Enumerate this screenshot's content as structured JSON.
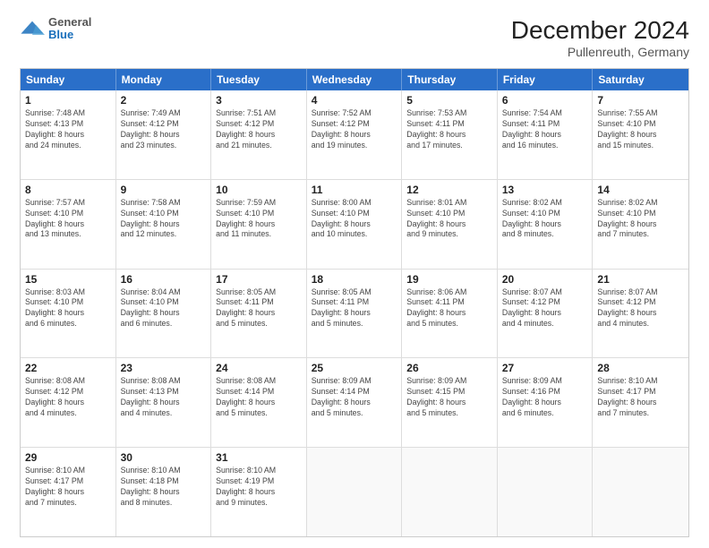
{
  "header": {
    "logo": {
      "general": "General",
      "blue": "Blue"
    },
    "title": "December 2024",
    "subtitle": "Pullenreuth, Germany"
  },
  "calendar": {
    "days_of_week": [
      "Sunday",
      "Monday",
      "Tuesday",
      "Wednesday",
      "Thursday",
      "Friday",
      "Saturday"
    ],
    "weeks": [
      [
        {
          "day": "",
          "info": ""
        },
        {
          "day": "2",
          "info": "Sunrise: 7:49 AM\nSunset: 4:12 PM\nDaylight: 8 hours\nand 23 minutes."
        },
        {
          "day": "3",
          "info": "Sunrise: 7:51 AM\nSunset: 4:12 PM\nDaylight: 8 hours\nand 21 minutes."
        },
        {
          "day": "4",
          "info": "Sunrise: 7:52 AM\nSunset: 4:12 PM\nDaylight: 8 hours\nand 19 minutes."
        },
        {
          "day": "5",
          "info": "Sunrise: 7:53 AM\nSunset: 4:11 PM\nDaylight: 8 hours\nand 17 minutes."
        },
        {
          "day": "6",
          "info": "Sunrise: 7:54 AM\nSunset: 4:11 PM\nDaylight: 8 hours\nand 16 minutes."
        },
        {
          "day": "7",
          "info": "Sunrise: 7:55 AM\nSunset: 4:10 PM\nDaylight: 8 hours\nand 15 minutes."
        }
      ],
      [
        {
          "day": "8",
          "info": "Sunrise: 7:57 AM\nSunset: 4:10 PM\nDaylight: 8 hours\nand 13 minutes."
        },
        {
          "day": "9",
          "info": "Sunrise: 7:58 AM\nSunset: 4:10 PM\nDaylight: 8 hours\nand 12 minutes."
        },
        {
          "day": "10",
          "info": "Sunrise: 7:59 AM\nSunset: 4:10 PM\nDaylight: 8 hours\nand 11 minutes."
        },
        {
          "day": "11",
          "info": "Sunrise: 8:00 AM\nSunset: 4:10 PM\nDaylight: 8 hours\nand 10 minutes."
        },
        {
          "day": "12",
          "info": "Sunrise: 8:01 AM\nSunset: 4:10 PM\nDaylight: 8 hours\nand 9 minutes."
        },
        {
          "day": "13",
          "info": "Sunrise: 8:02 AM\nSunset: 4:10 PM\nDaylight: 8 hours\nand 8 minutes."
        },
        {
          "day": "14",
          "info": "Sunrise: 8:02 AM\nSunset: 4:10 PM\nDaylight: 8 hours\nand 7 minutes."
        }
      ],
      [
        {
          "day": "15",
          "info": "Sunrise: 8:03 AM\nSunset: 4:10 PM\nDaylight: 8 hours\nand 6 minutes."
        },
        {
          "day": "16",
          "info": "Sunrise: 8:04 AM\nSunset: 4:10 PM\nDaylight: 8 hours\nand 6 minutes."
        },
        {
          "day": "17",
          "info": "Sunrise: 8:05 AM\nSunset: 4:11 PM\nDaylight: 8 hours\nand 5 minutes."
        },
        {
          "day": "18",
          "info": "Sunrise: 8:05 AM\nSunset: 4:11 PM\nDaylight: 8 hours\nand 5 minutes."
        },
        {
          "day": "19",
          "info": "Sunrise: 8:06 AM\nSunset: 4:11 PM\nDaylight: 8 hours\nand 5 minutes."
        },
        {
          "day": "20",
          "info": "Sunrise: 8:07 AM\nSunset: 4:12 PM\nDaylight: 8 hours\nand 4 minutes."
        },
        {
          "day": "21",
          "info": "Sunrise: 8:07 AM\nSunset: 4:12 PM\nDaylight: 8 hours\nand 4 minutes."
        }
      ],
      [
        {
          "day": "22",
          "info": "Sunrise: 8:08 AM\nSunset: 4:12 PM\nDaylight: 8 hours\nand 4 minutes."
        },
        {
          "day": "23",
          "info": "Sunrise: 8:08 AM\nSunset: 4:13 PM\nDaylight: 8 hours\nand 4 minutes."
        },
        {
          "day": "24",
          "info": "Sunrise: 8:08 AM\nSunset: 4:14 PM\nDaylight: 8 hours\nand 5 minutes."
        },
        {
          "day": "25",
          "info": "Sunrise: 8:09 AM\nSunset: 4:14 PM\nDaylight: 8 hours\nand 5 minutes."
        },
        {
          "day": "26",
          "info": "Sunrise: 8:09 AM\nSunset: 4:15 PM\nDaylight: 8 hours\nand 5 minutes."
        },
        {
          "day": "27",
          "info": "Sunrise: 8:09 AM\nSunset: 4:16 PM\nDaylight: 8 hours\nand 6 minutes."
        },
        {
          "day": "28",
          "info": "Sunrise: 8:10 AM\nSunset: 4:17 PM\nDaylight: 8 hours\nand 7 minutes."
        }
      ],
      [
        {
          "day": "29",
          "info": "Sunrise: 8:10 AM\nSunset: 4:17 PM\nDaylight: 8 hours\nand 7 minutes."
        },
        {
          "day": "30",
          "info": "Sunrise: 8:10 AM\nSunset: 4:18 PM\nDaylight: 8 hours\nand 8 minutes."
        },
        {
          "day": "31",
          "info": "Sunrise: 8:10 AM\nSunset: 4:19 PM\nDaylight: 8 hours\nand 9 minutes."
        },
        {
          "day": "",
          "info": ""
        },
        {
          "day": "",
          "info": ""
        },
        {
          "day": "",
          "info": ""
        },
        {
          "day": "",
          "info": ""
        }
      ]
    ],
    "week1_sun": {
      "day": "1",
      "info": "Sunrise: 7:48 AM\nSunset: 4:13 PM\nDaylight: 8 hours\nand 24 minutes."
    }
  }
}
